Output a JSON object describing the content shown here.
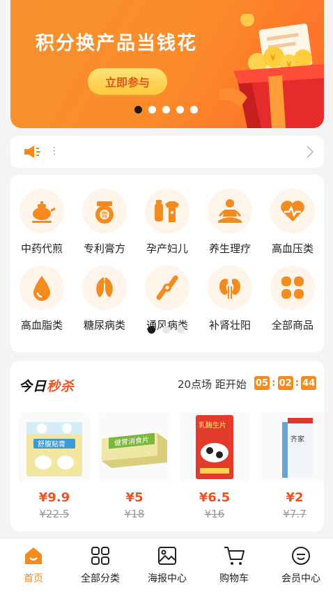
{
  "banner": {
    "title": "积分换产品当钱花",
    "button_label": "立即参与",
    "total_slides": 5,
    "active_slide": 1
  },
  "notice": {
    "icon": "speaker-icon",
    "separator": "⋮"
  },
  "categories": {
    "items": [
      {
        "label": "中药代煎",
        "icon": "herbal-pot-icon"
      },
      {
        "label": "专利膏方",
        "icon": "ointment-jar-icon"
      },
      {
        "label": "孕产妇儿",
        "icon": "baby-bottle-clothes-icon"
      },
      {
        "label": "养生理疗",
        "icon": "meditation-icon"
      },
      {
        "label": "高血压类",
        "icon": "heart-pulse-icon"
      },
      {
        "label": "高血脂类",
        "icon": "drop-icon"
      },
      {
        "label": "糖尿病类",
        "icon": "leaf-icon"
      },
      {
        "label": "通风病类",
        "icon": "joint-icon"
      },
      {
        "label": "补肾壮阳",
        "icon": "kidney-icon"
      },
      {
        "label": "全部商品",
        "icon": "clover-grid-icon"
      }
    ],
    "pages": 3,
    "active_page": 1
  },
  "flash_sale": {
    "title_prefix": "今日",
    "title_highlight": "秒杀",
    "session_label": "20点场 距开始",
    "timer": {
      "hours": "05",
      "minutes": "02",
      "seconds": "44"
    },
    "products": [
      {
        "price": "¥9.9",
        "original_price": "¥22.5",
        "package_text": "舒腹贴膏"
      },
      {
        "price": "¥5",
        "original_price": "¥18",
        "package_text": "健胃消食片"
      },
      {
        "price": "¥6.5",
        "original_price": "¥16",
        "package_text": "乳酶生片"
      },
      {
        "price": "¥2",
        "original_price": "¥7.7",
        "package_text": "齐家"
      }
    ]
  },
  "nav": {
    "items": [
      {
        "label": "首页",
        "icon": "home-icon"
      },
      {
        "label": "全部分类",
        "icon": "grid-icon"
      },
      {
        "label": "海报中心",
        "icon": "picture-icon"
      },
      {
        "label": "购物车",
        "icon": "cart-icon"
      },
      {
        "label": "会员中心",
        "icon": "member-face-icon"
      }
    ],
    "active_index": 0
  },
  "colors": {
    "accent": "#f58a1f",
    "price_red": "#f4511e",
    "banner_start": "#f7912e",
    "banner_end": "#ff6a2b",
    "icon_bg": "#fff4ea"
  }
}
